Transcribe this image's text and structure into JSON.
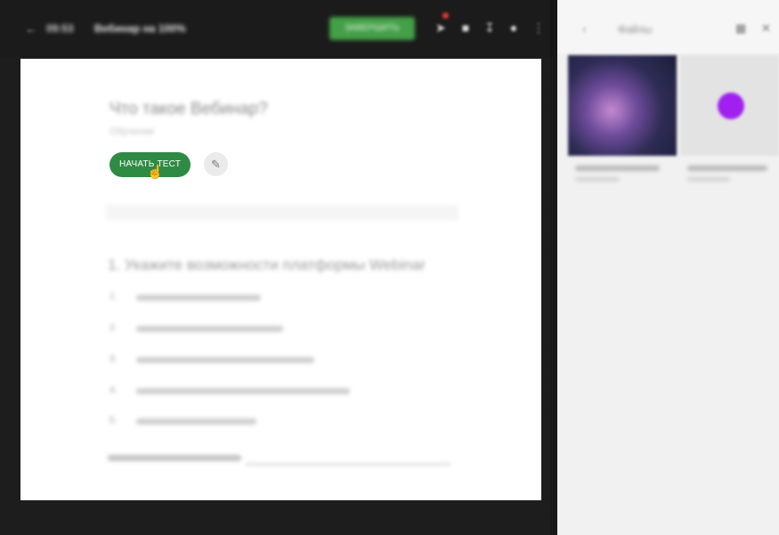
{
  "topbar": {
    "back_icon": "back-arrow-icon",
    "timer": "09:53",
    "title": "Вебинар на 100%",
    "action_button": "ЗАВЕРШИТЬ",
    "icons": [
      "rocket-icon",
      "chat-icon",
      "download-icon",
      "lock-icon",
      "more-icon"
    ]
  },
  "document": {
    "title": "Что такое Вебинар?",
    "subtitle": "Обучение",
    "start_button": "НАЧАТЬ ТЕСТ",
    "edit_icon": "pencil-icon",
    "question": "1. Укажите возможности платформы Webinar",
    "options": [
      {
        "num": "1."
      },
      {
        "num": "2."
      },
      {
        "num": "3."
      },
      {
        "num": "4."
      },
      {
        "num": "5."
      }
    ],
    "answer_label": "Ваш ответ"
  },
  "panel": {
    "title": "Файлы",
    "back_icon": "back-arrow-icon",
    "grid_icon": "grid-icon",
    "close_icon": "close-icon",
    "items": [
      {
        "thumb": "space-image"
      },
      {
        "thumb": "purple-dot"
      }
    ]
  },
  "colors": {
    "accent_green": "#2e8b43",
    "topbar_green": "#43a047",
    "purple": "#a020f0",
    "dark_bg": "#1d1d1d"
  }
}
